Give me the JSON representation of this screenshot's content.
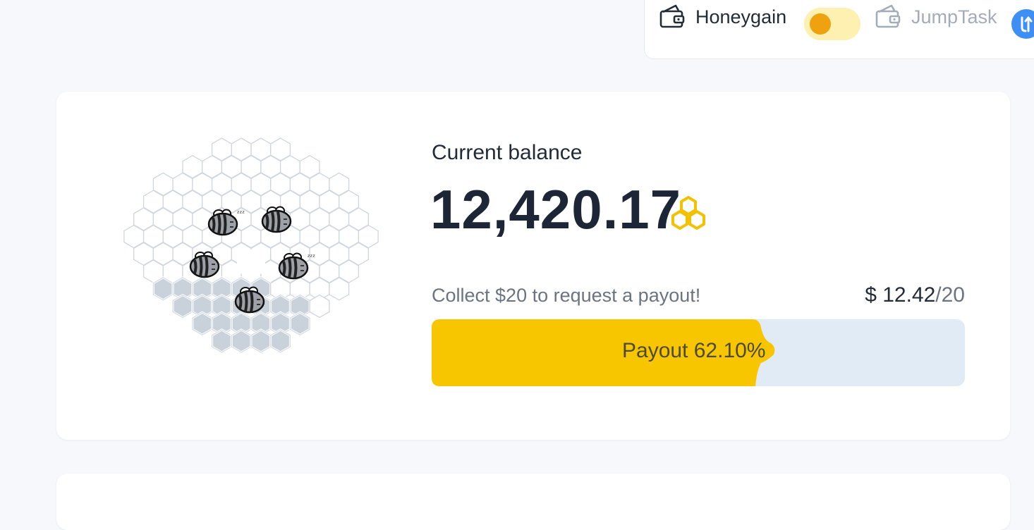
{
  "wallets": [
    {
      "label": "Honeygain",
      "icon": "wallet-icon",
      "active": true
    },
    {
      "label": "JumpTask",
      "icon": "wallet-icon",
      "active": false
    }
  ],
  "colors": {
    "honey_yellow": "#f7c600",
    "toggle_knob": "#efa20f",
    "toggle_track": "#fdf0b1",
    "progress_track": "#e1ebf5",
    "jumptask_blue": "#3d8ef5"
  },
  "balance": {
    "label": "Current balance",
    "value": "12,420.17",
    "icon": "honeycomb-coin-icon"
  },
  "payout": {
    "collect_text": "Collect $20 to request a payout!",
    "current": "$ 12.42",
    "goal": "/20",
    "progress_label": "Payout 62.10%",
    "progress_fraction": 0.621
  },
  "illustration": {
    "icon": "bee-hive-illustration",
    "bees": 5,
    "sleeping_bees": 2
  }
}
